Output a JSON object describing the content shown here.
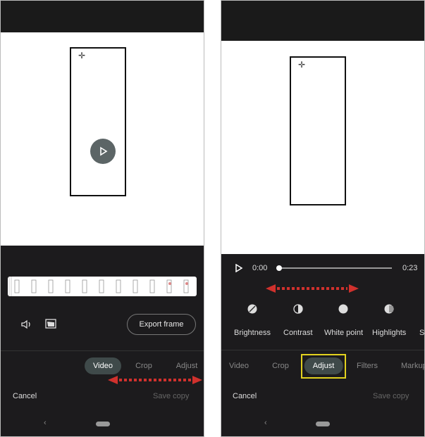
{
  "left": {
    "export_frame": "Export frame",
    "tabs": [
      "Video",
      "Crop",
      "Adjust"
    ],
    "active_tab": "Video",
    "cancel": "Cancel",
    "save_copy": "Save copy"
  },
  "right": {
    "time_start": "0:00",
    "time_end": "0:23",
    "progress": 0,
    "tools": [
      {
        "label": "Brightness",
        "icon": "brightness-icon"
      },
      {
        "label": "Contrast",
        "icon": "contrast-icon"
      },
      {
        "label": "White point",
        "icon": "white-point-icon"
      },
      {
        "label": "Highlights",
        "icon": "highlights-icon"
      },
      {
        "label": "S",
        "icon": ""
      }
    ],
    "tabs": [
      "Video",
      "Crop",
      "Adjust",
      "Filters",
      "Markup"
    ],
    "active_tab": "Adjust",
    "cancel": "Cancel",
    "save_copy": "Save copy"
  },
  "colors": {
    "annotation_arrow": "#d0312d",
    "highlight_box": "#e2d21f",
    "active_tab_bg": "#3f4a4a"
  }
}
